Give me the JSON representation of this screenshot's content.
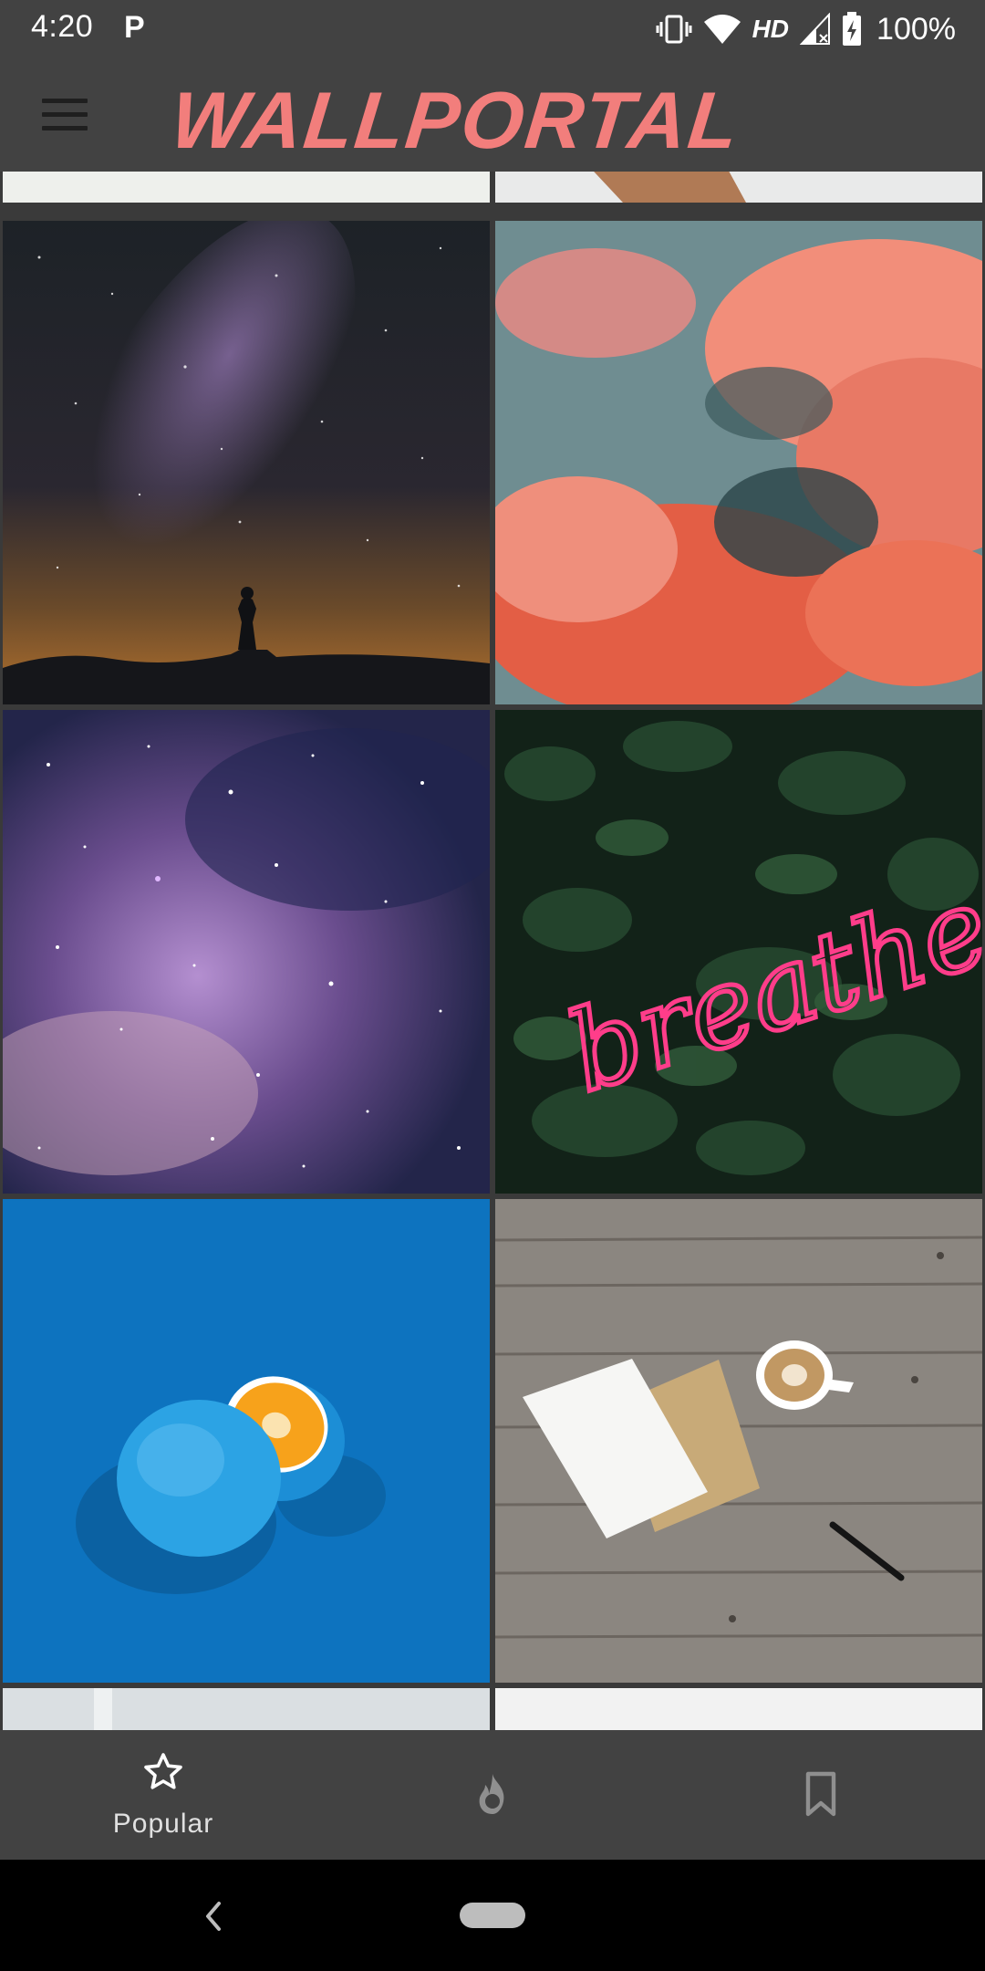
{
  "status_bar": {
    "time": "4:20",
    "app_icon": "P",
    "network_label": "HD",
    "battery": "100%",
    "icons": [
      "vibrate-icon",
      "wifi-icon",
      "signal-icon",
      "battery-icon"
    ]
  },
  "app_bar": {
    "title": "WALLPORTAL",
    "title_color": "#f27e7c",
    "menu_icon": "hamburger-menu-icon"
  },
  "wallpapers": [
    {
      "name": "partial-top-left"
    },
    {
      "name": "partial-top-right"
    },
    {
      "name": "milky-way-silhouette"
    },
    {
      "name": "pink-clouds"
    },
    {
      "name": "purple-galaxy"
    },
    {
      "name": "neon-breathe"
    },
    {
      "name": "blue-orange"
    },
    {
      "name": "coffee-desk"
    },
    {
      "name": "partial-bottom-left"
    },
    {
      "name": "partial-bottom-right"
    }
  ],
  "neon_text": "breathe",
  "bottom_nav": {
    "items": [
      {
        "label": "Popular",
        "icon": "star-icon",
        "selected": true
      },
      {
        "label": "",
        "icon": "flame-icon",
        "selected": false
      },
      {
        "label": "",
        "icon": "bookmark-icon",
        "selected": false
      }
    ]
  },
  "system_nav": {
    "back_icon": "back-chevron-icon",
    "home": "home-pill"
  }
}
